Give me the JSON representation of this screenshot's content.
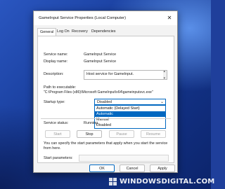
{
  "window": {
    "title": "GameInput Service Properties (Local Computer)",
    "close_glyph": "✕"
  },
  "tabs": [
    {
      "label": "General"
    },
    {
      "label": "Log On"
    },
    {
      "label": "Recovery"
    },
    {
      "label": "Dependencies"
    }
  ],
  "general": {
    "service_name_label": "Service name:",
    "service_name": "GameInput Service",
    "display_name_label": "Display name:",
    "display_name": "GameInput Service",
    "description_label": "Description:",
    "description": "Host service for GameInput.",
    "path_label": "Path to executable:",
    "path": "\"C:\\Program Files (x86)\\Microsoft GameInput\\x64\\gameinputsvc.exe\"",
    "startup_type_label": "Startup type:",
    "startup_type_selected": "Disabled",
    "startup_options": [
      "Automatic (Delayed Start)",
      "Automatic",
      "Manual",
      "Disabled"
    ],
    "startup_highlighted": "Automatic",
    "service_status_label": "Service status:",
    "service_status": "Running",
    "start_label": "Start",
    "stop_label": "Stop",
    "pause_label": "Pause",
    "resume_label": "Resume",
    "hint": "You can specify the start parameters that apply when you start the service from here.",
    "params_label": "Start parameters:",
    "params_value": ""
  },
  "footer": {
    "ok_label": "OK",
    "cancel_label": "Cancel",
    "apply_label": "Apply"
  },
  "watermark": {
    "text": "WINDOWSDIGITAL.COM"
  },
  "colors": {
    "accent": "#0067c0",
    "desktop": "#1f3f9b"
  }
}
